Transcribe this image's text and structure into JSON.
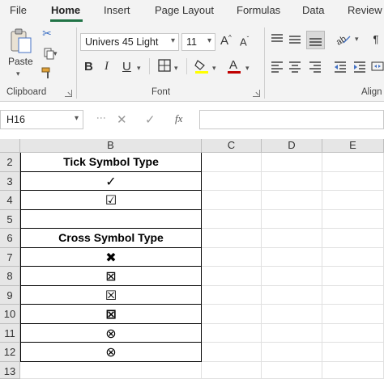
{
  "tabs": [
    "File",
    "Home",
    "Insert",
    "Page Layout",
    "Formulas",
    "Data",
    "Review"
  ],
  "ribbon": {
    "clipboard": {
      "paste_label": "Paste",
      "group_label": "Clipboard"
    },
    "font": {
      "font_name": "Univers 45 Light",
      "font_size": "11",
      "group_label": "Font",
      "bold": "B",
      "italic": "I",
      "underline": "U"
    },
    "alignment": {
      "group_label": "Align"
    }
  },
  "formula_bar": {
    "name_box": "H16",
    "fx_label": "fx",
    "value": ""
  },
  "columns": [
    "B",
    "C",
    "D",
    "E"
  ],
  "rows": [
    "2",
    "3",
    "4",
    "5",
    "6",
    "7",
    "8",
    "9",
    "10",
    "11",
    "12",
    "13"
  ],
  "cells": {
    "b2": "Tick Symbol Type",
    "b3": "✓",
    "b4": "☑",
    "b5": "",
    "b6": "Cross Symbol Type",
    "b7": "✖",
    "b8": "⊠",
    "b9": "☒",
    "b10": "⊠",
    "b11": "⊗",
    "b12": "⊗"
  },
  "colors": {
    "accent": "#217346",
    "ribbon_bg": "#f3f3f3",
    "header_bg": "#e6e6e6"
  }
}
